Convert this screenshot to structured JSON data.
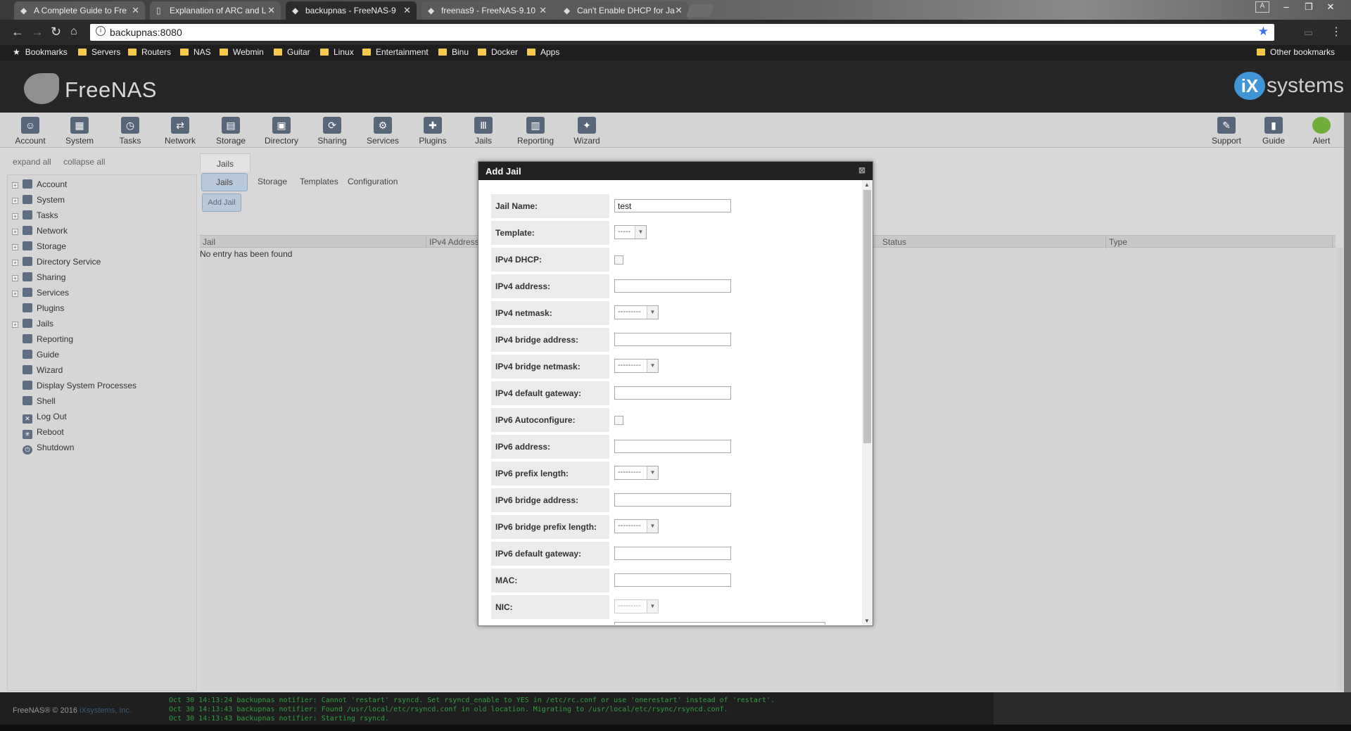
{
  "browser": {
    "tabs": [
      {
        "title": "A Complete Guide to Fre",
        "icon": "freenas-icon",
        "active": false
      },
      {
        "title": "Explanation of ARC and L",
        "icon": "document-icon",
        "active": false
      },
      {
        "title": "backupnas - FreeNAS-9",
        "icon": "freenas-icon",
        "active": true
      },
      {
        "title": "freenas9 - FreeNAS-9.10",
        "icon": "freenas-icon",
        "active": false
      },
      {
        "title": "Can't Enable DHCP for Ja",
        "icon": "freenas-icon",
        "active": false
      }
    ],
    "url": "backupnas:8080",
    "bookmarks": [
      "Bookmarks",
      "Servers",
      "Routers",
      "NAS",
      "Webmin",
      "Guitar",
      "Linux",
      "Entertainment",
      "Binu",
      "Docker",
      "Apps"
    ],
    "other_bookmarks": "Other bookmarks",
    "profile_initial": "A"
  },
  "header": {
    "logo_text": "FreeNAS",
    "brand_right_ix": "iX",
    "brand_right_text": "systems"
  },
  "topnav": [
    "Account",
    "System",
    "Tasks",
    "Network",
    "Storage",
    "Directory",
    "Sharing",
    "Services",
    "Plugins",
    "Jails",
    "Reporting",
    "Wizard"
  ],
  "topnav_right": [
    "Support",
    "Guide",
    "Alert"
  ],
  "sidebar": {
    "expand_all": "expand all",
    "collapse_all": "collapse all",
    "items": [
      {
        "label": "Account",
        "expandable": true
      },
      {
        "label": "System",
        "expandable": true
      },
      {
        "label": "Tasks",
        "expandable": true
      },
      {
        "label": "Network",
        "expandable": true
      },
      {
        "label": "Storage",
        "expandable": true
      },
      {
        "label": "Directory Service",
        "expandable": true
      },
      {
        "label": "Sharing",
        "expandable": true
      },
      {
        "label": "Services",
        "expandable": true
      },
      {
        "label": "Plugins",
        "expandable": false
      },
      {
        "label": "Jails",
        "expandable": true
      },
      {
        "label": "Reporting",
        "expandable": false
      },
      {
        "label": "Guide",
        "expandable": false
      },
      {
        "label": "Wizard",
        "expandable": false
      },
      {
        "label": "Display System Processes",
        "expandable": false
      },
      {
        "label": "Shell",
        "expandable": false
      },
      {
        "label": "Log Out",
        "expandable": false
      },
      {
        "label": "Reboot",
        "expandable": false
      },
      {
        "label": "Shutdown",
        "expandable": false
      }
    ]
  },
  "main": {
    "tab": "Jails",
    "subtabs": [
      "Jails",
      "Storage",
      "Templates",
      "Configuration"
    ],
    "add_button": "Add Jail",
    "columns": [
      "Jail",
      "IPv4 Address",
      "Status",
      "Type"
    ],
    "empty_text": "No entry has been found"
  },
  "modal": {
    "title": "Add Jail",
    "fields": {
      "jail_name": {
        "label": "Jail Name:",
        "value": "test"
      },
      "template": {
        "label": "Template:",
        "value": "-----"
      },
      "ipv4_dhcp": {
        "label": "IPv4 DHCP:"
      },
      "ipv4_address": {
        "label": "IPv4 address:"
      },
      "ipv4_netmask": {
        "label": "IPv4 netmask:",
        "value": "---------"
      },
      "ipv4_bridge_address": {
        "label": "IPv4 bridge address:"
      },
      "ipv4_bridge_netmask": {
        "label": "IPv4 bridge netmask:",
        "value": "---------"
      },
      "ipv4_default_gateway": {
        "label": "IPv4 default gateway:"
      },
      "ipv6_autoconfigure": {
        "label": "IPv6 Autoconfigure:"
      },
      "ipv6_address": {
        "label": "IPv6 address:"
      },
      "ipv6_prefix_length": {
        "label": "IPv6 prefix length:",
        "value": "---------"
      },
      "ipv6_bridge_address": {
        "label": "IPv6 bridge address:"
      },
      "ipv6_bridge_prefix_length": {
        "label": "IPv6 bridge prefix length:",
        "value": "---------"
      },
      "ipv6_default_gateway": {
        "label": "IPv6 default gateway:"
      },
      "mac": {
        "label": "MAC:"
      },
      "nic": {
        "label": "NIC:",
        "value": "---------"
      }
    }
  },
  "footer": {
    "copyright": "FreeNAS® © 2016",
    "company": "iXsystems, Inc.",
    "console_lines": [
      "Oct 30 14:13:24 backupnas notifier: Cannot 'restart' rsyncd. Set rsyncd_enable to YES in /etc/rc.conf or use 'onerestart' instead of 'restart'.",
      "Oct 30 14:13:43 backupnas notifier: Found /usr/local/etc/rsyncd.conf in old location. Migrating to /usr/local/etc/rsync/rsyncd.conf.",
      "Oct 30 14:13:43 backupnas notifier: Starting rsyncd."
    ]
  }
}
